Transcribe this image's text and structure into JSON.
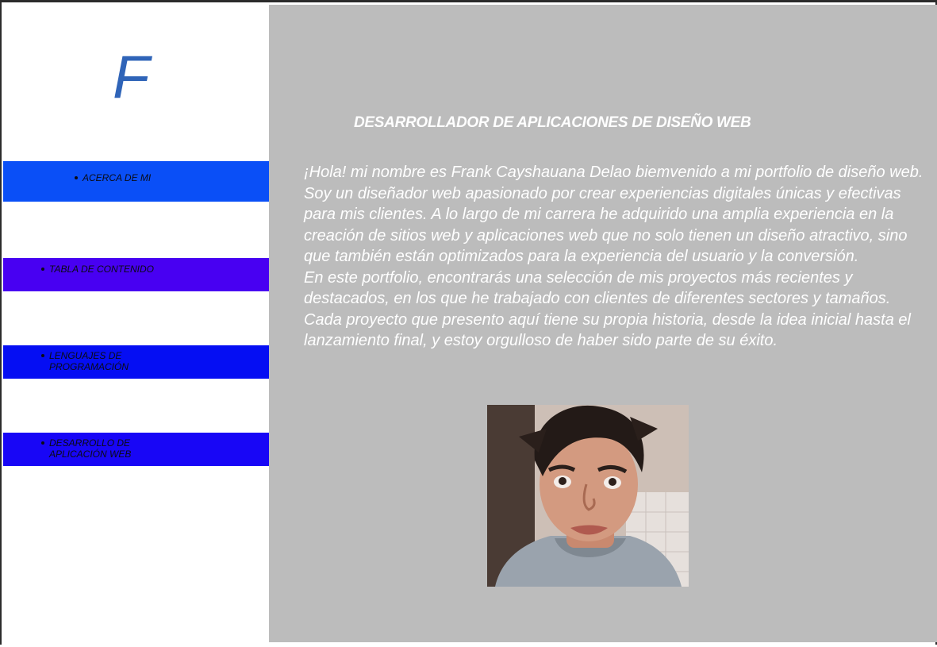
{
  "sidebar": {
    "logo_letter": "F",
    "nav": [
      {
        "label": "ACERCA DE MI"
      },
      {
        "label": "TABLA DE CONTENIDO"
      },
      {
        "label": "LENGUAJES DE PROGRAMACIÓN"
      },
      {
        "label": "DESARROLLO DE APLICACIÓN WEB"
      }
    ]
  },
  "main": {
    "headline": "DESARROLLADOR DE APLICACIONES DE DISEÑO WEB",
    "paragraph_1": "¡Hola! mi nombre es Frank Cayshauana Delao  biemvenido a mi portfolio de diseño web. Soy un diseñador web apasionado por crear experiencias digitales únicas y efectivas para mis clientes. A lo largo de mi carrera he adquirido una amplia experiencia en la creación de sitios web y aplicaciones web que no solo tienen un diseño atractivo, sino que también están optimizados para la experiencia del usuario y la conversión.",
    "paragraph_2": "En este portfolio, encontrarás una selección de mis proyectos más recientes y destacados, en los que he trabajado con clientes de diferentes sectores y tamaños. Cada proyecto que presento aquí tiene su propia historia, desde la idea inicial hasta el lanzamiento final, y estoy orgulloso de haber sido parte de su éxito."
  },
  "colors": {
    "logo": "#2f64b8",
    "nav_1": "#0a4ff7",
    "nav_2": "#4800f2",
    "nav_3": "#050ef3",
    "nav_4": "#1806f6",
    "main_background": "#bcbcbc"
  }
}
